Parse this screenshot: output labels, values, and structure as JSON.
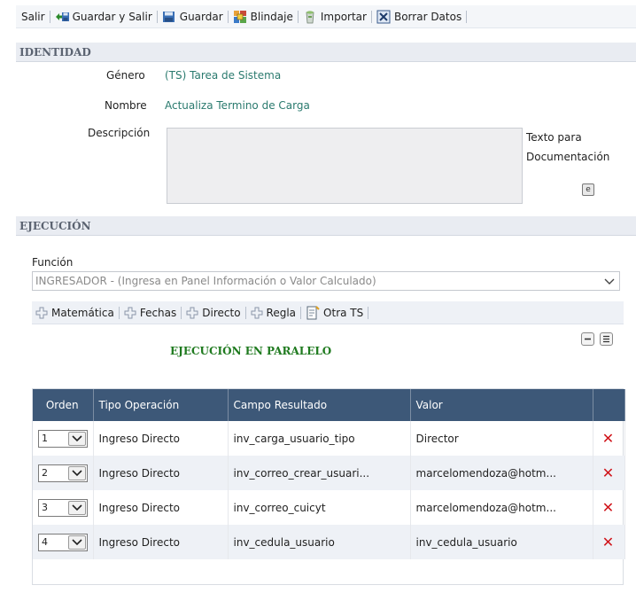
{
  "toolbar": {
    "items": [
      {
        "label": "Salir",
        "icon": "exit-icon"
      },
      {
        "label": "Guardar y Salir",
        "icon": "save-exit-icon"
      },
      {
        "label": "Guardar",
        "icon": "save-icon"
      },
      {
        "label": "Blindaje",
        "icon": "shield-lock-icon"
      },
      {
        "label": "Importar",
        "icon": "import-icon"
      },
      {
        "label": "Borrar Datos",
        "icon": "delete-data-icon"
      }
    ]
  },
  "identidad": {
    "section_title": "IDENTIDAD",
    "genero_label": "Género",
    "genero_value": "(TS) Tarea de Sistema",
    "nombre_label": "Nombre",
    "nombre_value": "Actualiza Termino de Carga",
    "descripcion_label": "Descripción",
    "descripcion_value": "",
    "doc_note_line1": "Texto para",
    "doc_note_line2": "Documentación",
    "doc_icon_glyph": "e"
  },
  "ejecucion": {
    "section_title": "EJECUCIÓN",
    "funcion_label": "Función",
    "funcion_value": "INGRESADOR - (Ingresa en Panel Información o Valor Calculado)",
    "subtoolbar": [
      {
        "label": "Matemática",
        "icon": "plus-icon"
      },
      {
        "label": "Fechas",
        "icon": "plus-icon"
      },
      {
        "label": "Directo",
        "icon": "plus-icon"
      },
      {
        "label": "Regla",
        "icon": "plus-icon"
      },
      {
        "label": "Otra TS",
        "icon": "new-doc-icon"
      }
    ],
    "parallel_title": "EJECUCIÓN EN PARALELO"
  },
  "grid": {
    "columns": [
      "Orden",
      "Tipo Operación",
      "Campo Resultado",
      "Valor",
      ""
    ],
    "rows": [
      {
        "orden": "1",
        "tipo": "Ingreso Directo",
        "campo": "inv_carga_usuario_tipo",
        "valor": "Director"
      },
      {
        "orden": "2",
        "tipo": "Ingreso Directo",
        "campo": "inv_correo_crear_usuari...",
        "valor": "marcelomendoza@hotm..."
      },
      {
        "orden": "3",
        "tipo": "Ingreso Directo",
        "campo": "inv_correo_cuicyt",
        "valor": "marcelomendoza@hotm..."
      },
      {
        "orden": "4",
        "tipo": "Ingreso Directo",
        "campo": "inv_cedula_usuario",
        "valor": "inv_cedula_usuario"
      }
    ],
    "delete_glyph": "✕"
  },
  "colors": {
    "header_bg": "#3d5878",
    "value_text": "#2a7a6e",
    "parallel_title": "#1f7a1f",
    "delete": "#d0141a"
  }
}
